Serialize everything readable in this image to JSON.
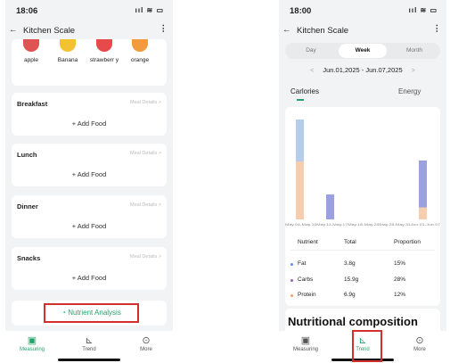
{
  "left": {
    "time": "18:06",
    "signal": "ııl ≋ ▭",
    "title": "Kitchen Scale",
    "fruits": [
      {
        "label": "apple",
        "color": "#e05353"
      },
      {
        "label": "Banana",
        "color": "#f2c230"
      },
      {
        "label": "strawberr y",
        "color": "#e8494b"
      },
      {
        "label": "orange",
        "color": "#f39a3c"
      }
    ],
    "meals": [
      {
        "title": "Breakfast",
        "details": "Meal Details  >",
        "add": "+ Add Food"
      },
      {
        "title": "Lunch",
        "details": "Meal Details  >",
        "add": "+ Add Food"
      },
      {
        "title": "Dinner",
        "details": "Meal Details  >",
        "add": "+ Add Food"
      },
      {
        "title": "Snacks",
        "details": "Meal Details  >",
        "add": "+ Add Food"
      }
    ],
    "analysis": "Nutrient Analysis",
    "tabs": [
      "Measuring",
      "Trend",
      "More"
    ]
  },
  "right": {
    "time": "18:00",
    "signal": "ııl ≋ ▭",
    "title": "Kitchen Scale",
    "segments": [
      "Day",
      "Week",
      "Month"
    ],
    "range": "Jun.01,2025 - Jun.07,2025",
    "metrics": [
      "Carlories",
      "Energy"
    ],
    "chart_data": {
      "type": "bar",
      "categories": [
        "May.04-May.10",
        "May.11-May.17",
        "May.18-May.24",
        "May.25-May.31",
        "Jun.01-Jun.07"
      ],
      "series": [
        {
          "color": "#f7cdb0",
          "values": [
            0.58,
            0,
            0,
            0,
            0.12
          ]
        },
        {
          "color": "#9aa1de",
          "values": [
            0,
            0.25,
            0,
            0,
            0.47
          ]
        },
        {
          "color": "#b6cdea",
          "values": [
            0.42,
            0,
            0,
            0,
            0
          ]
        }
      ],
      "axis_text": "May.04-May.10May.11-May.17May.18-May.24May.25-May.31Jun.01-Jun.07"
    },
    "table_headers": [
      "Nutrient",
      "Total",
      "Proportion"
    ],
    "rows": [
      {
        "name": "Fat",
        "total": "3.8g",
        "prop": "15%",
        "color": "#5b8ff9"
      },
      {
        "name": "Carbs",
        "total": "15.9g",
        "prop": "28%",
        "color": "#9661bc"
      },
      {
        "name": "Protein",
        "total": "6.9g",
        "prop": "12%",
        "color": "#f6a25c"
      }
    ],
    "composition": "Nutritional composition",
    "tabs": [
      "Measuring",
      "Trend",
      "More"
    ]
  }
}
